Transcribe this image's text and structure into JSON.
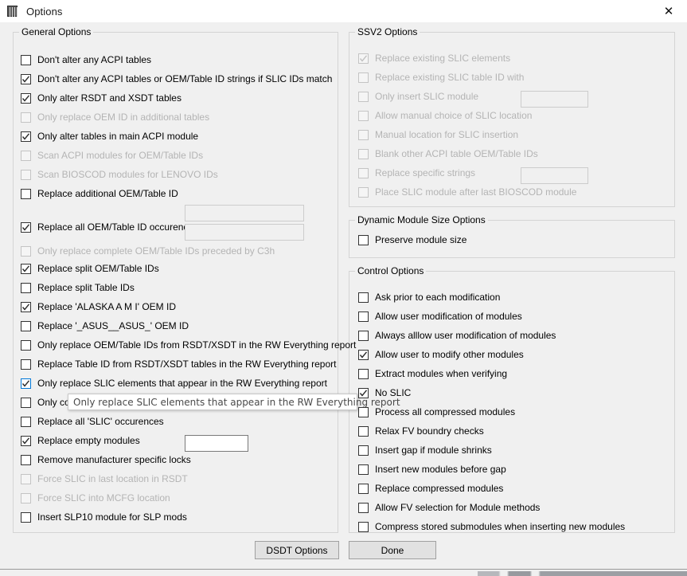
{
  "window": {
    "title": "Options",
    "icon": "chip-icon",
    "close_label": "✕"
  },
  "groups": {
    "general": {
      "legend": "General Options"
    },
    "ssv2": {
      "legend": "SSV2 Options"
    },
    "dynamic": {
      "legend": "Dynamic Module Size Options"
    },
    "control": {
      "legend": "Control Options"
    }
  },
  "general_options": [
    {
      "label": "Don't alter any ACPI tables",
      "checked": false,
      "disabled": false
    },
    {
      "label": "Don't alter any ACPI tables or OEM/Table ID strings if SLIC IDs match",
      "checked": true,
      "disabled": false
    },
    {
      "label": "Only alter RSDT and XSDT tables",
      "checked": true,
      "disabled": false
    },
    {
      "label": "Only replace OEM ID in additional tables",
      "checked": false,
      "disabled": true
    },
    {
      "label": "Only alter tables in main ACPI module",
      "checked": true,
      "disabled": false
    },
    {
      "label": "Scan ACPI modules for OEM/Table IDs",
      "checked": false,
      "disabled": true
    },
    {
      "label": "Scan BIOSCOD modules for LENOVO IDs",
      "checked": false,
      "disabled": true
    },
    {
      "label": "Replace additional OEM/Table ID",
      "checked": false,
      "disabled": false
    },
    {
      "label": "Replace all OEM/Table ID occurences",
      "checked": true,
      "disabled": false
    },
    {
      "label": "Only replace complete OEM/Table IDs preceded by C3h",
      "checked": false,
      "disabled": true
    },
    {
      "label": "Replace split OEM/Table IDs",
      "checked": true,
      "disabled": false
    },
    {
      "label": "Replace split Table IDs",
      "checked": false,
      "disabled": false
    },
    {
      "label": "Replace 'ALASKA A M I'  OEM ID",
      "checked": true,
      "disabled": false
    },
    {
      "label": "Replace '_ASUS__ASUS_' OEM ID",
      "checked": false,
      "disabled": false
    },
    {
      "label": "Only replace OEM/Table IDs from RSDT/XSDT in the RW Everything report",
      "checked": false,
      "disabled": false
    },
    {
      "label": "Replace Table ID from RSDT/XSDT tables in the RW Everything report",
      "checked": false,
      "disabled": false
    },
    {
      "label": "Only replace SLIC elements that appear in the RW Everything report",
      "checked": true,
      "disabled": false,
      "hover": true
    },
    {
      "label": "Only cop",
      "checked": false,
      "disabled": false
    },
    {
      "label": "Replace all 'SLIC' occurences",
      "checked": false,
      "disabled": false
    },
    {
      "label": "Replace empty modules",
      "checked": true,
      "disabled": false
    },
    {
      "label": "Remove manufacturer specific locks",
      "checked": false,
      "disabled": false
    },
    {
      "label": "Force SLIC in last location in RSDT",
      "checked": false,
      "disabled": true
    },
    {
      "label": "Force SLIC into MCFG location",
      "checked": false,
      "disabled": true
    },
    {
      "label": "Insert SLP10 module for SLP mods",
      "checked": false,
      "disabled": false
    }
  ],
  "general_fields": {
    "additional_oem_id_1": {
      "value": "",
      "disabled": true
    },
    "additional_oem_id_2": {
      "value": "",
      "disabled": true
    },
    "slic_occurences": {
      "value": "",
      "disabled": false
    }
  },
  "ssv2_options": [
    {
      "label": "Replace existing SLIC elements",
      "checked": true,
      "disabled": true
    },
    {
      "label": "Replace existing SLIC table ID with",
      "checked": false,
      "disabled": true
    },
    {
      "label": "Only insert SLIC module",
      "checked": false,
      "disabled": true
    },
    {
      "label": "Allow manual choice of SLIC location",
      "checked": false,
      "disabled": true
    },
    {
      "label": "Manual location for SLIC insertion",
      "checked": false,
      "disabled": true
    },
    {
      "label": "Blank other ACPI table OEM/Table IDs",
      "checked": false,
      "disabled": true
    },
    {
      "label": "Replace specific strings",
      "checked": false,
      "disabled": true
    },
    {
      "label": "Place SLIC module after last BIOSCOD module",
      "checked": false,
      "disabled": true
    }
  ],
  "ssv2_fields": {
    "slic_table_id": {
      "value": "",
      "disabled": true
    },
    "blank_other_ids": {
      "value": "",
      "disabled": true
    }
  },
  "dynamic_options": [
    {
      "label": "Preserve module size",
      "checked": false,
      "disabled": false
    }
  ],
  "control_options": [
    {
      "label": "Ask prior to each modification",
      "checked": false,
      "disabled": false
    },
    {
      "label": "Allow user modification of modules",
      "checked": false,
      "disabled": false
    },
    {
      "label": "Always alllow user modification of modules",
      "checked": false,
      "disabled": false
    },
    {
      "label": "Allow user to modify other modules",
      "checked": true,
      "disabled": false
    },
    {
      "label": "Extract modules when verifying",
      "checked": false,
      "disabled": false
    },
    {
      "label": "No SLIC",
      "checked": true,
      "disabled": false
    },
    {
      "label": "Process all compressed modules",
      "checked": false,
      "disabled": false
    },
    {
      "label": "Relax FV boundry checks",
      "checked": false,
      "disabled": false
    },
    {
      "label": "Insert gap if module shrinks",
      "checked": false,
      "disabled": false
    },
    {
      "label": "Insert new modules before gap",
      "checked": false,
      "disabled": false
    },
    {
      "label": "Replace compressed modules",
      "checked": false,
      "disabled": false
    },
    {
      "label": "Allow FV selection for Module methods",
      "checked": false,
      "disabled": false
    },
    {
      "label": "Compress stored submodules when inserting new modules",
      "checked": false,
      "disabled": false
    }
  ],
  "buttons": {
    "dsdt_options": "DSDT Options",
    "done": "Done"
  },
  "tooltip": {
    "text": "Only replace SLIC elements that appear in the RW Everything report"
  },
  "colors": {
    "dialog_bg": "#f0f0f0",
    "titlebar_bg": "#ffffff",
    "group_border": "#d4d4d4",
    "checkbox_border": "#333333",
    "checkbox_disabled_border": "#c4c4c4",
    "disabled_text": "#b4b4b4",
    "hover_accent": "#0078d7",
    "button_face": "#e1e1e1",
    "button_border": "#a0a0a0"
  }
}
